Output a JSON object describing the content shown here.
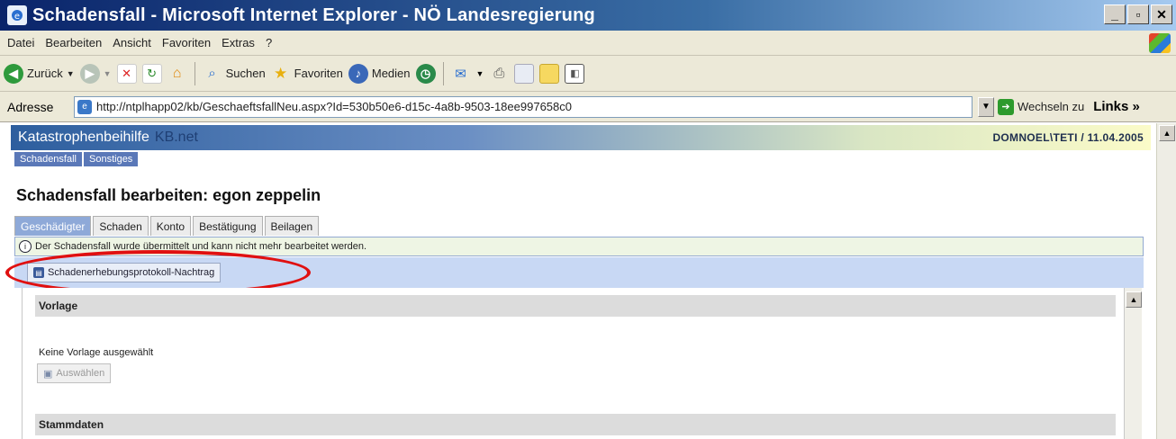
{
  "window": {
    "title": "Schadensfall - Microsoft Internet Explorer - NÖ Landesregierung",
    "min_label": "_",
    "max_label": "▫",
    "close_label": "✕"
  },
  "menu": [
    "Datei",
    "Bearbeiten",
    "Ansicht",
    "Favoriten",
    "Extras",
    "?"
  ],
  "toolbar": {
    "back_label": "Zurück",
    "search_label": "Suchen",
    "favorites_label": "Favoriten",
    "media_label": "Medien"
  },
  "address": {
    "label": "Adresse",
    "url": "http://ntplhapp02/kb/GeschaeftsfallNeu.aspx?Id=530b50e6-d15c-4a8b-9503-18ee997658c0",
    "go_label": "Wechseln zu",
    "links_label": "Links »"
  },
  "app": {
    "name": "Katastrophenbeihilfe",
    "subtitle": "KB.net",
    "user_date": "DOMNOEL\\TETI / 11.04.2005",
    "nav": [
      "Schadensfall",
      "Sonstiges"
    ]
  },
  "page": {
    "title": "Schadensfall bearbeiten: egon zeppelin",
    "tabs": [
      {
        "label": "Geschädigter",
        "active": true
      },
      {
        "label": "Schaden",
        "active": false
      },
      {
        "label": "Konto",
        "active": false
      },
      {
        "label": "Bestätigung",
        "active": false
      },
      {
        "label": "Beilagen",
        "active": false
      }
    ],
    "info_message": "Der Schadensfall wurde übermittelt und kann nicht mehr bearbeitet werden.",
    "action_button": "Schadenerhebungsprotokoll-Nachtrag"
  },
  "panel": {
    "section1": "Vorlage",
    "no_template": "Keine Vorlage ausgewählt",
    "choose_button": "Auswählen",
    "section2": "Stammdaten"
  },
  "colors": {
    "highlight_ellipse": "#e01010",
    "active_tab": "#8ea9d8",
    "action_row": "#c8d8f4"
  }
}
